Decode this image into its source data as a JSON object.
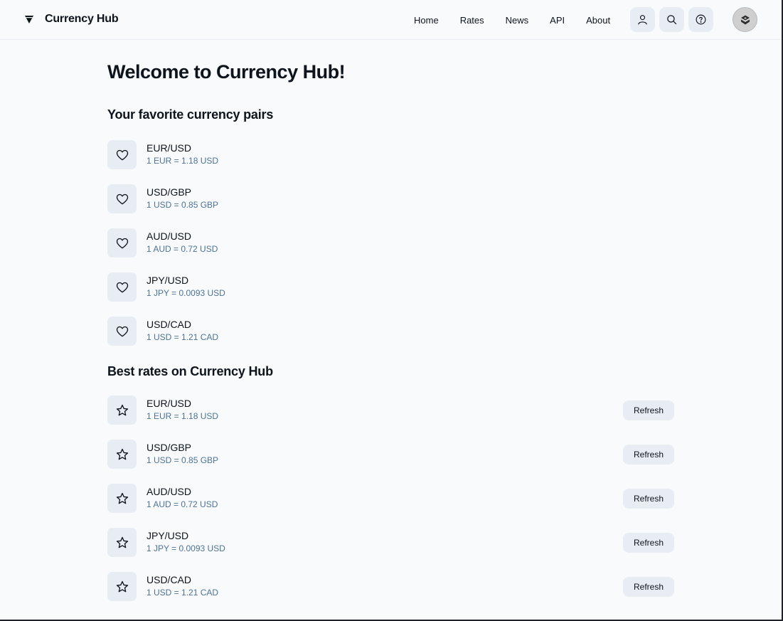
{
  "header": {
    "brand": "Currency Hub",
    "nav": [
      "Home",
      "Rates",
      "News",
      "API",
      "About"
    ],
    "icons": [
      "user-icon",
      "search-icon",
      "help-icon"
    ]
  },
  "main": {
    "title": "Welcome to Currency Hub!",
    "favorites": {
      "title": "Your favorite currency pairs",
      "icon": "heart-icon",
      "items": [
        {
          "pair": "EUR/USD",
          "rate": "1 EUR = 1.18 USD"
        },
        {
          "pair": "USD/GBP",
          "rate": "1 USD = 0.85 GBP"
        },
        {
          "pair": "AUD/USD",
          "rate": "1 AUD = 0.72 USD"
        },
        {
          "pair": "JPY/USD",
          "rate": "1 JPY = 0.0093 USD"
        },
        {
          "pair": "USD/CAD",
          "rate": "1 USD = 1.21 CAD"
        }
      ]
    },
    "best_rates": {
      "title": "Best rates on Currency Hub",
      "icon": "star-icon",
      "button_label": "Refresh",
      "items": [
        {
          "pair": "EUR/USD",
          "rate": "1 EUR = 1.18 USD"
        },
        {
          "pair": "USD/GBP",
          "rate": "1 USD = 0.85 GBP"
        },
        {
          "pair": "AUD/USD",
          "rate": "1 AUD = 0.72 USD"
        },
        {
          "pair": "JPY/USD",
          "rate": "1 JPY = 0.0093 USD"
        },
        {
          "pair": "USD/CAD",
          "rate": "1 USD = 1.21 CAD"
        }
      ]
    }
  },
  "colors": {
    "background": "#f8fafc",
    "chip": "#e7edf3",
    "text": "#0e141b",
    "secondary_text": "#4e7397"
  }
}
